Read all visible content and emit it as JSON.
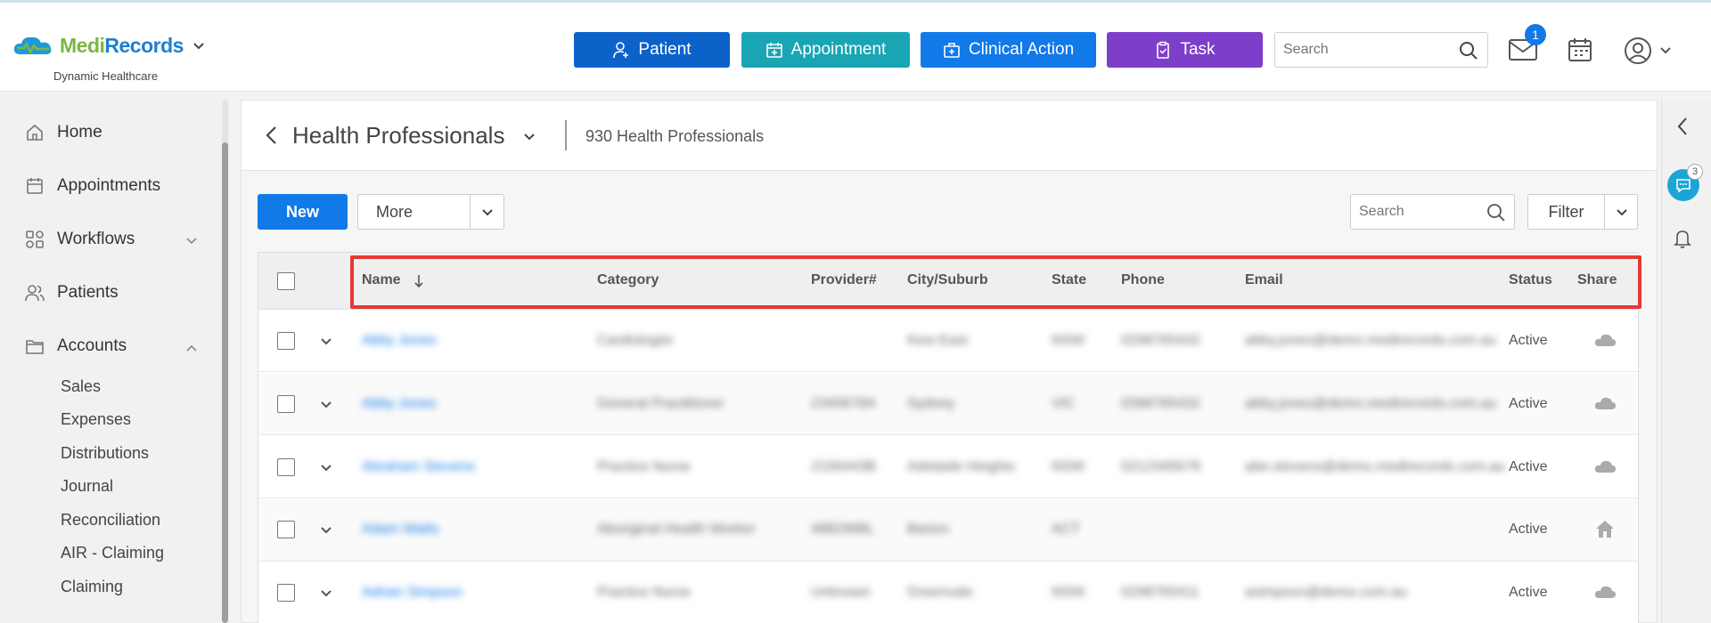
{
  "brand": {
    "name_part1": "Medi",
    "name_part2": "Records",
    "subtitle": "Dynamic Healthcare",
    "color_green": "#7cb642",
    "color_blue": "#1f7fd0"
  },
  "topbar": {
    "buttons": [
      {
        "label": "Patient",
        "icon": "person-add-icon",
        "color": "#0d62c9"
      },
      {
        "label": "Appointment",
        "icon": "calendar-plus-icon",
        "color": "#1aa5b4"
      },
      {
        "label": "Clinical Action",
        "icon": "medical-kit-icon",
        "color": "#1279e8"
      },
      {
        "label": "Task",
        "icon": "clipboard-check-icon",
        "color": "#7d3fc9"
      }
    ],
    "search_placeholder": "Search",
    "mail_badge": "1"
  },
  "sidebar": {
    "items": [
      {
        "label": "Home",
        "icon": "home-icon"
      },
      {
        "label": "Appointments",
        "icon": "calendar-icon"
      },
      {
        "label": "Workflows",
        "icon": "workflow-icon",
        "expanded": false
      },
      {
        "label": "Patients",
        "icon": "users-icon"
      },
      {
        "label": "Accounts",
        "icon": "folder-icon",
        "expanded": true
      }
    ],
    "sub_items": [
      "Sales",
      "Expenses",
      "Distributions",
      "Journal",
      "Reconciliation",
      "AIR - Claiming",
      "Claiming"
    ]
  },
  "page": {
    "title": "Health Professionals",
    "count": "930 Health Professionals"
  },
  "toolbar": {
    "new_label": "New",
    "more_label": "More",
    "search_placeholder": "Search",
    "filter_label": "Filter"
  },
  "table": {
    "columns": [
      "Name",
      "Category",
      "Provider#",
      "City/Suburb",
      "State",
      "Phone",
      "Email",
      "Status",
      "Share"
    ],
    "sort": {
      "column": "Name",
      "direction": "descending"
    },
    "rows": [
      {
        "name": "Abby Jones",
        "category": "Cardiologist",
        "provider": "",
        "city": "Kew East",
        "state": "NSW",
        "phone": "0298765432",
        "email": "abby.jones@demo.medirecords.com.au",
        "status": "Active",
        "share": "cloud-icon"
      },
      {
        "name": "Abby Jones",
        "category": "General Practitioner",
        "provider": "2345678A",
        "city": "Sydney",
        "state": "VIC",
        "phone": "0398765432",
        "email": "abby.jones@demo.medirecords.com.au",
        "status": "Active",
        "share": "cloud-icon"
      },
      {
        "name": "Abraham Stevens",
        "category": "Practice Nurse",
        "provider": "2156443B",
        "city": "Adelaide Heights",
        "state": "NSW",
        "phone": "0212345678",
        "email": "abe.stevens@demo.medirecords.com.au",
        "status": "Active",
        "share": "cloud-icon"
      },
      {
        "name": "Adam Watts",
        "category": "Aboriginal Health Worker",
        "provider": "4882998L",
        "city": "Barton",
        "state": "ACT",
        "phone": "",
        "email": "",
        "status": "Active",
        "share": "home-icon"
      },
      {
        "name": "Adrian Simpson",
        "category": "Practice Nurse",
        "provider": "Unknown",
        "city": "Greenvale",
        "state": "NSW",
        "phone": "0298765411",
        "email": "asimpson@demo.com.au",
        "status": "Active",
        "share": "cloud-icon"
      }
    ]
  },
  "rail": {
    "chat_badge": "3"
  }
}
